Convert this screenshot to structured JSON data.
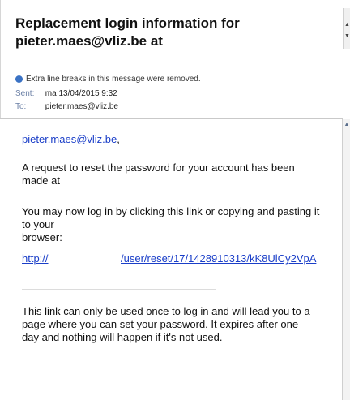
{
  "header": {
    "subject": "Replacement login information for pieter.maes@vliz.be at",
    "info_text": "Extra line breaks in this message were removed.",
    "sent_label": "Sent:",
    "sent_value": "ma 13/04/2015 9:32",
    "to_label": "To:",
    "to_value": "pieter.maes@vliz.be"
  },
  "body": {
    "greeting_link": "pieter.maes@vliz.be",
    "greeting_suffix": ",",
    "paragraph1_line1": "A request to reset the password for your account has been",
    "paragraph1_line2": "made at",
    "paragraph2_line1": "You may now log in by clicking this link or copying and pasting it",
    "paragraph2_line2": "to your",
    "paragraph2_line3": "browser:",
    "reset_link_prefix": "http://",
    "reset_link_path": "/user/reset/17/1428910313/kK8UlCy2VpA",
    "paragraph3_line1": "This link can only be used once to log in and will lead you to a",
    "paragraph3_line2": "page where you can set your password. It expires after one",
    "paragraph3_line3": "day and nothing will happen if it's not used."
  },
  "icons": {
    "info": "info-icon",
    "scroll_up": "scroll-up-icon",
    "scroll_down": "scroll-down-icon"
  },
  "colors": {
    "link": "#1a3ec8",
    "info_icon": "#3a72c4"
  }
}
